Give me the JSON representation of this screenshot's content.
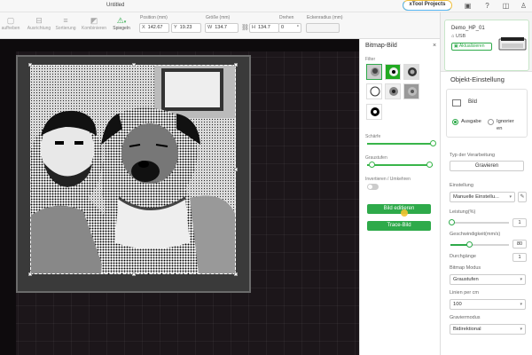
{
  "app": {
    "title": "Untitled"
  },
  "topbar": {
    "xtool_label": "xTool Projects",
    "tools": [
      {
        "label": "aufheben"
      },
      {
        "label": "Ausrichtung"
      },
      {
        "label": "Sortierung"
      },
      {
        "label": "Kombinieren"
      },
      {
        "label": "Spiegeln"
      }
    ],
    "position_label": "Position (mm)",
    "size_label": "Größe (mm)",
    "rotate_label": "Drehen",
    "radius_label": "Eckenradius (mm)",
    "x_key": "X",
    "x_value": "142.67",
    "y_key": "Y",
    "y_value": "19.23",
    "w_key": "W",
    "w_value": "134.7",
    "h_key": "H",
    "h_value": "134.7",
    "rotate_value": "0",
    "rotate_unit": "°"
  },
  "bitmap_panel": {
    "title": "Bitmap-Bild",
    "close": "×",
    "filter_label": "Filter",
    "sharpness_label": "Schärfe",
    "grayscale_label": "Graustufen",
    "invert_label": "Invertieren / Umkehren",
    "edit_button": "Bild editieren",
    "trace_button": "Trace-Bild",
    "sharpness_level": 1.0,
    "grayscale_low": 0.05,
    "grayscale_high": 0.95
  },
  "device": {
    "name": "Demo_HP_01",
    "connection": "USB",
    "update_label": "Aktualisieren"
  },
  "object_settings": {
    "title": "Objekt-Einstellung",
    "item_label": "Bild",
    "output_label": "Ausgabe",
    "ignore_label": "Ignorier",
    "ignore_label_2": "en",
    "process_type_label": "Typ der Verarbeitung",
    "process_button": "Gravieren",
    "setting_label": "Einstellung",
    "setting_value": "Manuelle Einstellu...",
    "power_label": "Leistung(%)",
    "power_value": "1",
    "power_level": 0.01,
    "speed_label": "Geschwindigkeit(mm/s)",
    "speed_value": "80",
    "speed_level": 0.3,
    "passes_label": "Durchgänge",
    "passes_value": "1",
    "bitmap_mode_label": "Bitmap Modus",
    "bitmap_mode_value": "Graustufen",
    "lines_label": "Linien per cm",
    "lines_value": "100",
    "engrave_mode_label": "Graviermodus",
    "engrave_mode_value": "Bidirektional"
  }
}
